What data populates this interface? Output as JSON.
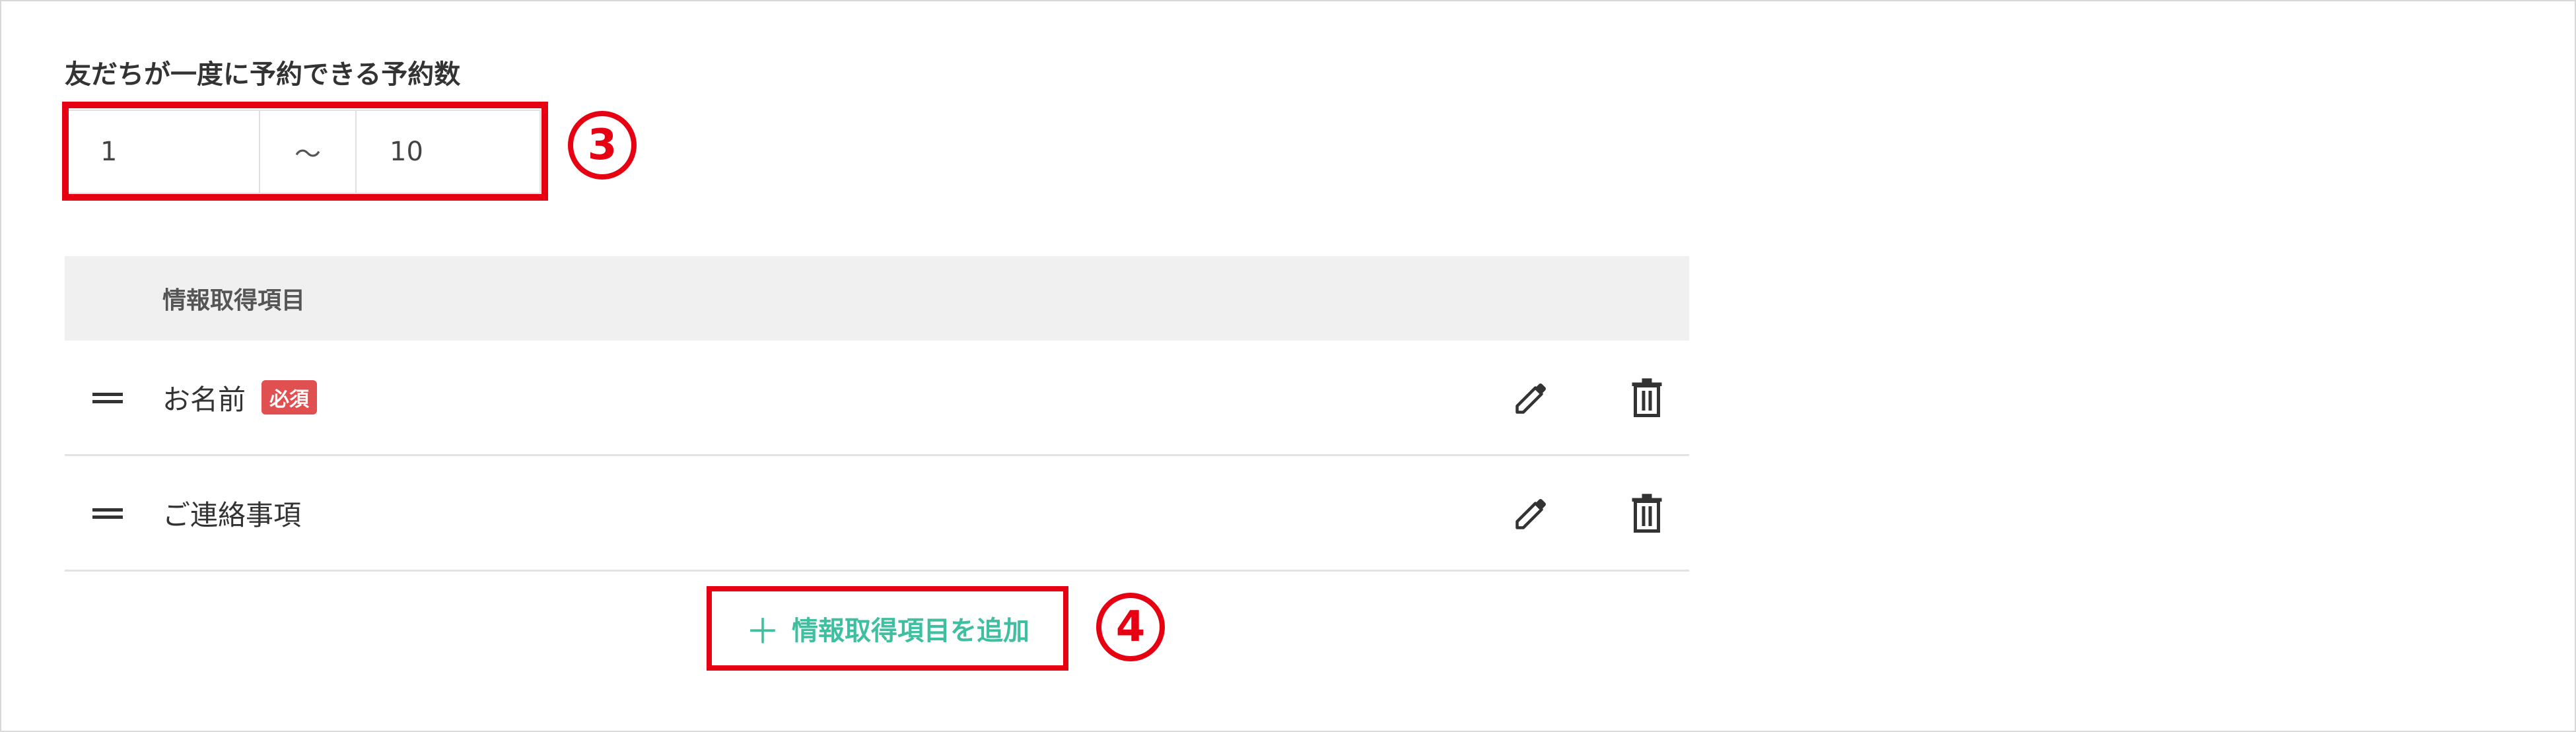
{
  "section": {
    "label": "友だちが一度に予約できる予約数"
  },
  "range": {
    "min": "1",
    "separator": "〜",
    "max": "10"
  },
  "annotations": {
    "mark3": "3",
    "mark4": "4",
    "highlight_color": "#e60012"
  },
  "table": {
    "header": "情報取得項目",
    "rows": [
      {
        "label": "お名前",
        "badge": "必須"
      },
      {
        "label": "ご連絡事項",
        "badge": ""
      }
    ]
  },
  "add_button": {
    "icon": "plus-icon",
    "label": "情報取得項目を追加"
  },
  "colors": {
    "accent": "#3fbf9f",
    "badge": "#e05050",
    "header_bg": "#f0f0f1"
  }
}
